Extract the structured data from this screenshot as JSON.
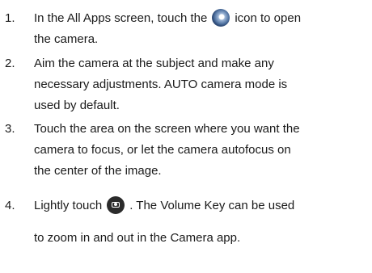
{
  "steps": [
    {
      "number": "1.",
      "line1_before_icon": "In the All Apps screen, touch the",
      "icon": "camera-app-icon",
      "line1_after_icon": "icon to open",
      "line2": "the camera."
    },
    {
      "number": "2.",
      "lines": [
        "Aim the camera at the subject and make any",
        "necessary adjustments. AUTO camera mode is",
        "used by default."
      ]
    },
    {
      "number": "3.",
      "lines": [
        "Touch the area on the screen where you want the",
        "camera to focus, or let the camera autofocus on",
        "the center of the image."
      ]
    },
    {
      "number": "4.",
      "line1_before_icon": "Lightly touch",
      "icon": "shutter-icon",
      "line1_after_icon": ". The Volume Key can be used",
      "line2": "to zoom in and out in the Camera app."
    }
  ]
}
